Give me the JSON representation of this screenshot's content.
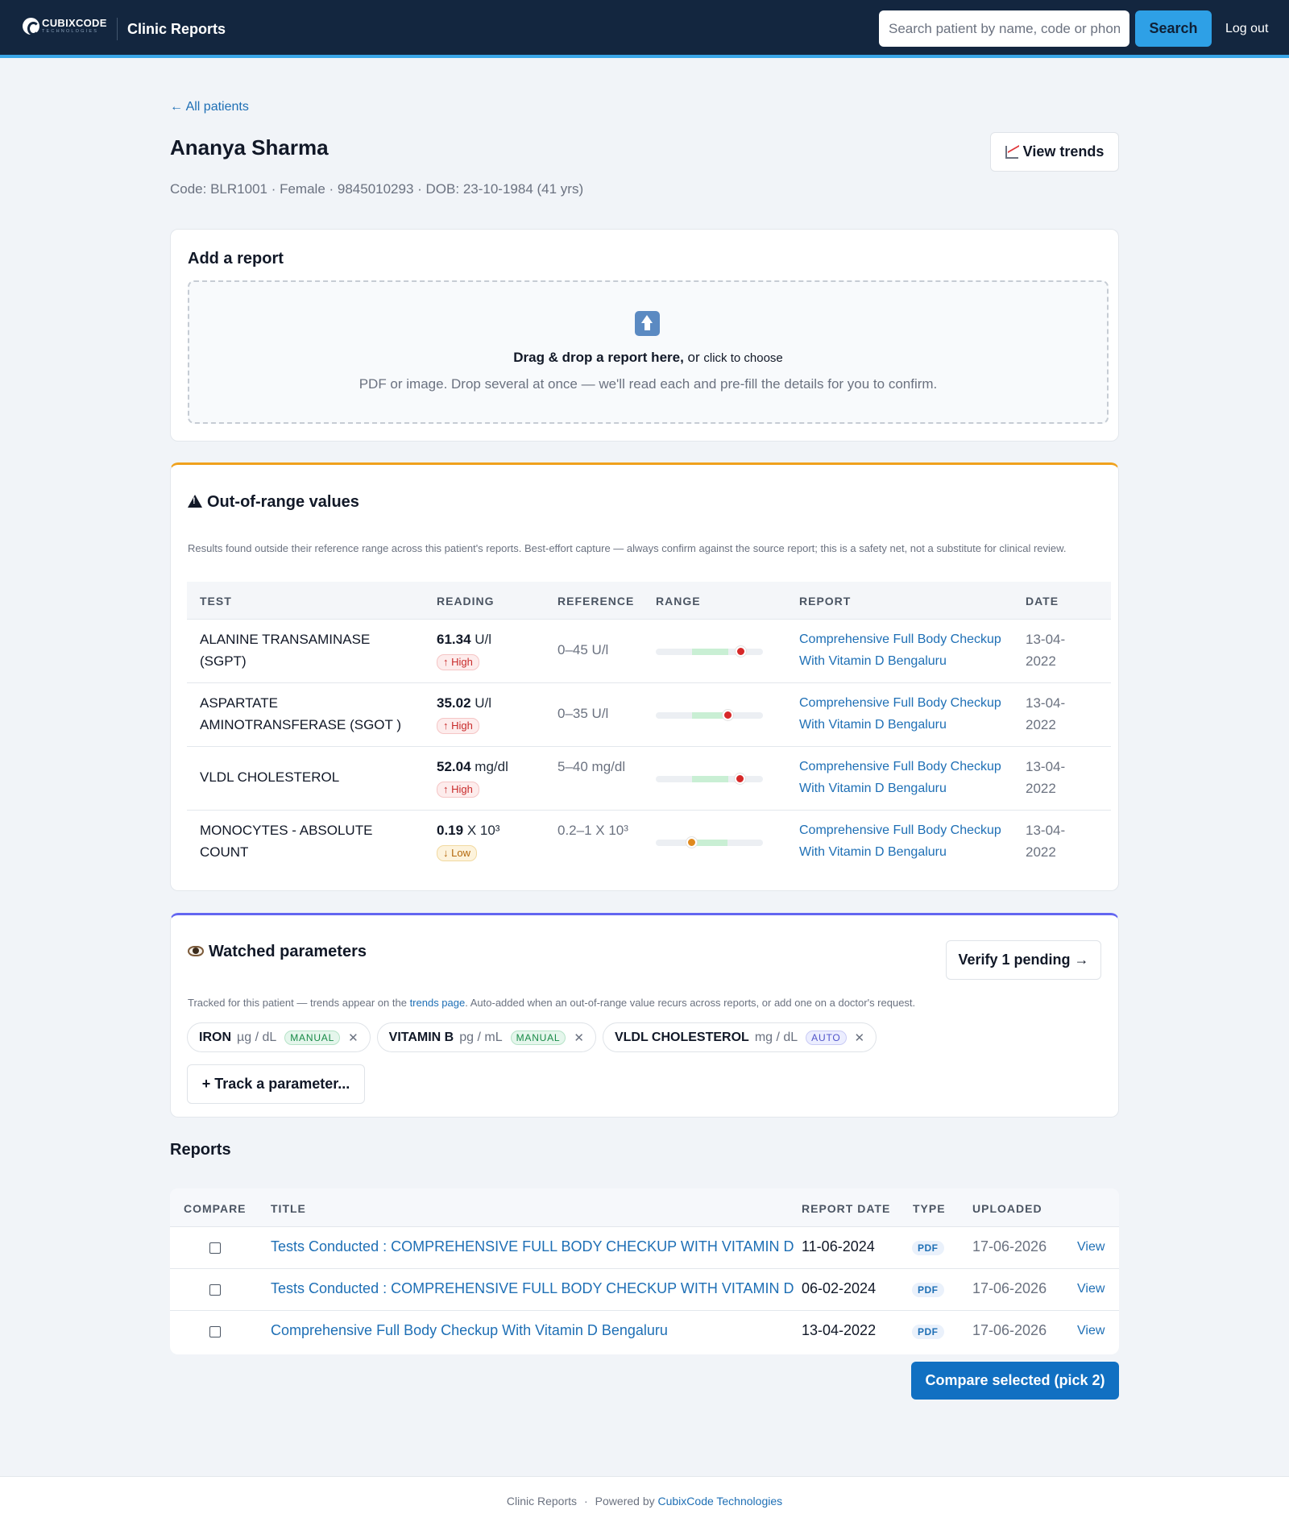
{
  "header": {
    "logo_name": "CUBIXCODE",
    "logo_sub": "TECHNOLOGIES",
    "app_title": "Clinic Reports",
    "search_placeholder": "Search patient by name, code or phone",
    "search_label": "Search",
    "logout_label": "Log out"
  },
  "back_link": "← All patients",
  "patient": {
    "name": "Ananya Sharma",
    "meta": "Code: BLR1001 · Female · 9845010293 · DOB: 23-10-1984 (41 yrs)",
    "view_trends_label": "View trends"
  },
  "add_report": {
    "title": "Add a report",
    "drop_main": "Drag & drop a report here,",
    "drop_or": " or ",
    "drop_choose": "click to choose",
    "drop_hint": "PDF or image. Drop several at once — we'll read each and pre-fill the details for you to confirm."
  },
  "out_of_range": {
    "title": "Out-of-range values",
    "accent_color": "#f0a11c",
    "note": "Results found outside their reference range across this patient's reports. Best-effort capture — always confirm against the source report; this is a safety net, not a substitute for clinical review.",
    "columns": [
      "TEST",
      "READING",
      "REFERENCE",
      "RANGE",
      "REPORT",
      "DATE"
    ],
    "rows": [
      {
        "test": "ALANINE TRANSAMINASE (SGPT)",
        "value": "61.34",
        "unit": "U/l",
        "flag": "↑ High",
        "flag_type": "high",
        "reference": "0–45 U/l",
        "range_normal": [
          0.34,
          0.68
        ],
        "range_marker": 0.79,
        "report": "Comprehensive Full Body Checkup With Vitamin D Bengaluru",
        "date": "13-04-2022"
      },
      {
        "test": "ASPARTATE AMINOTRANSFERASE (SGOT )",
        "value": "35.02",
        "unit": "U/l",
        "flag": "↑ High",
        "flag_type": "high",
        "reference": "0–35 U/l",
        "range_normal": [
          0.34,
          0.67
        ],
        "range_marker": 0.67,
        "report": "Comprehensive Full Body Checkup With Vitamin D Bengaluru",
        "date": "13-04-2022"
      },
      {
        "test": "VLDL CHOLESTEROL",
        "value": "52.04",
        "unit": "mg/dl",
        "flag": "↑ High",
        "flag_type": "high",
        "reference": "5–40 mg/dl",
        "range_normal": [
          0.34,
          0.68
        ],
        "range_marker": 0.78,
        "report": "Comprehensive Full Body Checkup With Vitamin D Bengaluru",
        "date": "13-04-2022"
      },
      {
        "test": "MONOCYTES - ABSOLUTE COUNT",
        "value": "0.19",
        "unit": "X 10³",
        "flag": "↓ Low",
        "flag_type": "low",
        "reference": "0.2–1 X 10³",
        "range_normal": [
          0.34,
          0.67
        ],
        "range_marker": 0.33,
        "report": "Comprehensive Full Body Checkup With Vitamin D Bengaluru",
        "date": "13-04-2022"
      }
    ]
  },
  "watched": {
    "title": "Watched parameters",
    "accent_color": "#6366f1",
    "verify_label": "Verify 1 pending →",
    "note_before": "Tracked for this patient — trends appear on the ",
    "note_link": "trends page",
    "note_after": ". Auto-added when an out-of-range value recurs across reports, or add one on a doctor's request.",
    "chips": [
      {
        "name": "IRON",
        "unit": "µg / dL",
        "tag": "MANUAL",
        "tag_type": "manual"
      },
      {
        "name": "VITAMIN B",
        "unit": "pg / mL",
        "tag": "MANUAL",
        "tag_type": "manual"
      },
      {
        "name": "VLDL CHOLESTEROL",
        "unit": "mg / dL",
        "tag": "AUTO",
        "tag_type": "auto"
      }
    ],
    "remove_glyph": "✕",
    "track_label": "+ Track a parameter..."
  },
  "reports": {
    "title": "Reports",
    "columns": [
      "COMPARE",
      "TITLE",
      "REPORT DATE",
      "TYPE",
      "UPLOADED"
    ],
    "rows": [
      {
        "title": "Tests Conducted : COMPREHENSIVE FULL BODY CHECKUP WITH VITAMIN D",
        "report_date": "11-06-2024",
        "type": "PDF",
        "uploaded": "17-06-2026",
        "action": "View"
      },
      {
        "title": "Tests Conducted : COMPREHENSIVE FULL BODY CHECKUP WITH VITAMIN D",
        "report_date": "06-02-2024",
        "type": "PDF",
        "uploaded": "17-06-2026",
        "action": "View"
      },
      {
        "title": "Comprehensive Full Body Checkup With Vitamin D Bengaluru",
        "report_date": "13-04-2022",
        "type": "PDF",
        "uploaded": "17-06-2026",
        "action": "View"
      }
    ],
    "compare_label": "Compare selected (pick 2)"
  },
  "footer": {
    "app": "Clinic Reports",
    "separator": "·",
    "powered_by": "Powered by ",
    "company": "CubixCode Technologies"
  },
  "colors": {
    "header_bg": "#13263f",
    "header_accent": "#3aa6e8",
    "link": "#1e6fb5",
    "high": "#c82b2b",
    "low": "#b3670b",
    "marker_high": "#d62828",
    "marker_low": "#e08a1e"
  }
}
